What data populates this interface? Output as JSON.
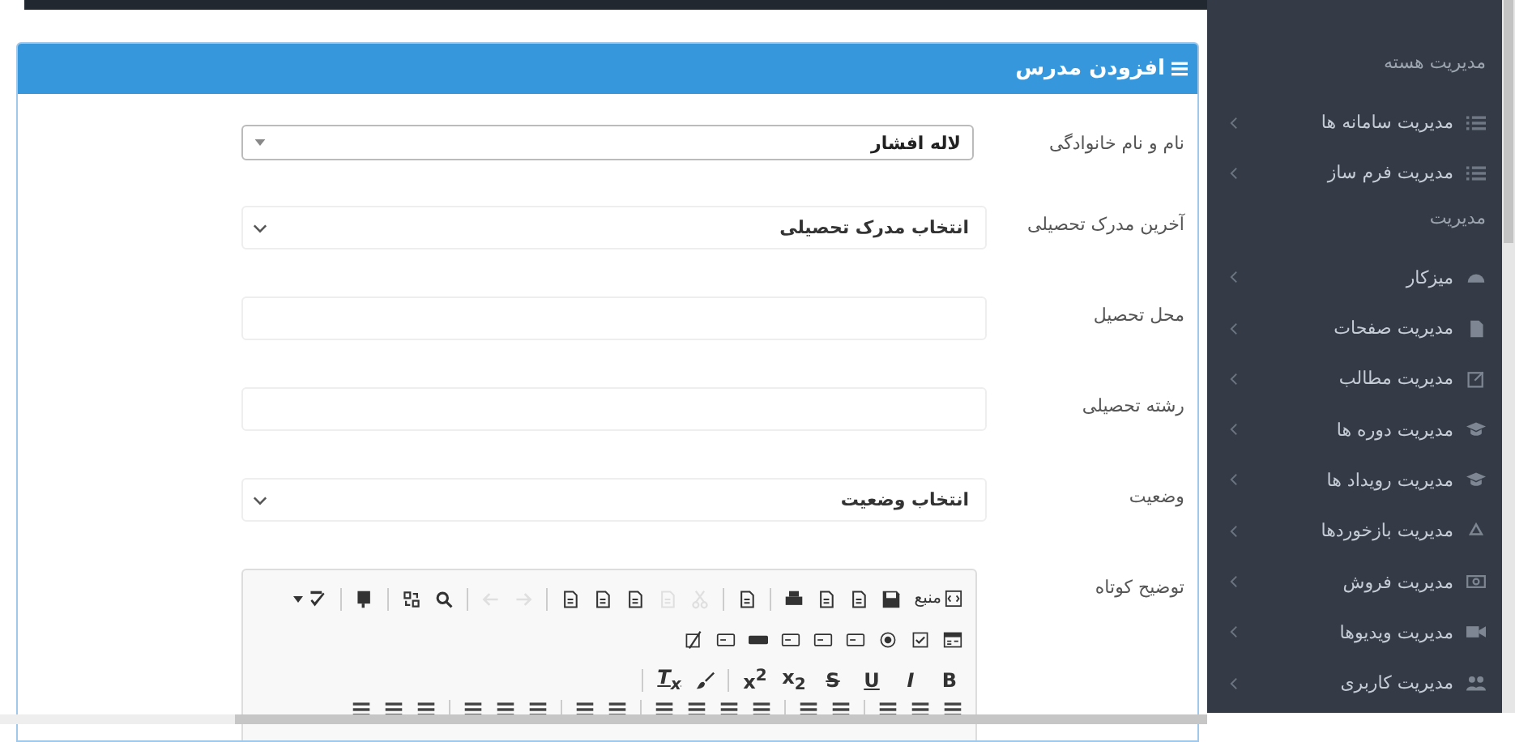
{
  "panel": {
    "title": "افزودن مدرس"
  },
  "form": [
    {
      "kind": "combo",
      "label": "نام و نام خانوادگی",
      "value": "لاله افشار"
    },
    {
      "kind": "select",
      "label": "آخرین مدرک تحصیلی",
      "value": "انتخاب مدرک تحصیلی"
    },
    {
      "kind": "input",
      "label": "محل تحصیل"
    },
    {
      "kind": "input",
      "label": "رشته تحصیلی"
    },
    {
      "kind": "select",
      "label": "وضعیت",
      "value": "انتخاب وضعیت"
    },
    {
      "kind": "editor",
      "label": "توضیح کوتاه"
    }
  ],
  "editor": {
    "source_label": "منبع",
    "format_buttons": [
      "B",
      "I",
      "U",
      "S",
      "x$_{2}$",
      "x$^{2}$"
    ],
    "clear_label": "T$_{x}$"
  },
  "sidebar": [
    {
      "kind": "header",
      "label": "مدیریت هسته"
    },
    {
      "kind": "item",
      "label": "مدیریت سامانه ها"
    },
    {
      "kind": "item",
      "label": "مدیریت فرم ساز"
    },
    {
      "kind": "header",
      "label": "مدیریت"
    },
    {
      "kind": "item",
      "label": "میزکار"
    },
    {
      "kind": "item",
      "label": "مدیریت صفحات"
    },
    {
      "kind": "item",
      "label": "مدیریت مطالب"
    },
    {
      "kind": "item",
      "label": "مدیریت دوره ها"
    },
    {
      "kind": "item",
      "label": "مدیریت رویداد ها"
    },
    {
      "kind": "item",
      "label": "مدیریت بازخوردها"
    },
    {
      "kind": "item",
      "label": "مدیریت فروش"
    },
    {
      "kind": "item",
      "label": "مدیریت ویدیوها"
    },
    {
      "kind": "item",
      "label": "مدیریت کاربری"
    }
  ]
}
